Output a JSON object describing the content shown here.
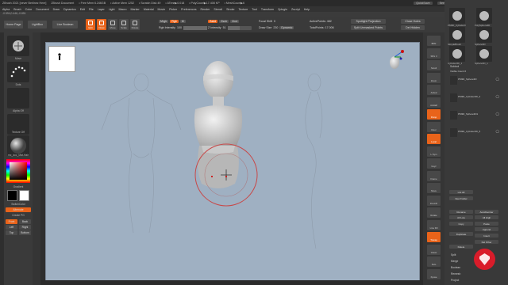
{
  "titlebar": {
    "app_title": "ZBrush 2021 [never Berlinez Here]",
    "document": "ZBrush Document",
    "free_mem": "• Free Mem 6.246GB",
    "active_mem": "• Active Mem 1252",
    "scratch": "• Scratch Disk 49",
    "atime": "• ATime▶0.018",
    "polycount": "• PolyCount▶17.408 KP",
    "meshcount": "• MeshCount▶6",
    "quicksave": "QuickSave",
    "see_through": "See-through  0",
    "menus": "Menus",
    "default_script": "DefaultZScript"
  },
  "menubar": [
    "Alpha",
    "Brush",
    "Color",
    "Document",
    "Draw",
    "Dynamics",
    "Edit",
    "File",
    "Layer",
    "Light",
    "Macro",
    "Marker",
    "Material",
    "Movie",
    "Picker",
    "Preferences",
    "Render",
    "Stencil",
    "Stroke",
    "Texture",
    "Tool",
    "Transform",
    "Zplugin",
    "Zscript",
    "Help"
  ],
  "coords": "-0.594,0.446,-0.851",
  "shelf": {
    "home_page": "Home Page",
    "lightbox": "LightBox",
    "live_boolean": "Live Boolean",
    "tools": [
      {
        "label": "Edit",
        "active": true
      },
      {
        "label": "Draw",
        "active": true
      },
      {
        "label": "Move",
        "active": false
      },
      {
        "label": "Scale",
        "active": false
      },
      {
        "label": "Rotate",
        "active": false
      }
    ],
    "mrgb": "Mrgb",
    "rgb": "Rgb",
    "m": "M",
    "rgb_intensity_label": "Rgb Intensity",
    "rgb_intensity_value": "100",
    "rgb_intensity": 1.0,
    "zadd": "Zadd",
    "zsub": "Zsub",
    "zcut": "Zcut",
    "z_intensity_label": "Z Intensity",
    "z_intensity_value": "51",
    "z_intensity": 0.51,
    "focal_shift_label": "Focal Shift",
    "focal_shift_value": "0",
    "draw_size_label": "Draw Size",
    "draw_size_value": "230",
    "dynamic": "Dynamic",
    "active_points": "ActivePoints: 482",
    "total_points": "TotalPoints: 17.006",
    "spotlight": "Spotlight Projection",
    "split_unmasked": "Split Unmasked Points",
    "close_holes": "Close Holes",
    "del_hidden": "Del Hidden"
  },
  "leftpanel": {
    "brush": "Move",
    "stroke": "Dots",
    "alpha": "Alpha Off",
    "texture": "Texture Off",
    "material": "mc_doc_Mat-Hair",
    "gradient": "Gradient",
    "switch_color": "SwitchColor",
    "alternate": "Alternate",
    "create_pc": "Create PG",
    "front": "Front",
    "back": "Back",
    "left": "Left",
    "right": "Right",
    "top": "Top",
    "bottom": "Bottom",
    "primary_color": "#000000",
    "secondary_color": "#ffffff"
  },
  "rtools": [
    {
      "label": "BPR",
      "active": false
    },
    {
      "label": "SPix 3",
      "active": false
    },
    {
      "label": "Scroll",
      "active": false
    },
    {
      "label": "Zoom",
      "active": false
    },
    {
      "label": "Actual",
      "active": false
    },
    {
      "label": "AAHalf",
      "active": false
    },
    {
      "label": "Persp",
      "active": true
    },
    {
      "label": "Floor",
      "active": false
    },
    {
      "label": "Local",
      "active": true
    },
    {
      "label": "L.Sym",
      "active": false
    },
    {
      "label": "Gxyz",
      "active": false
    },
    {
      "label": "Frame",
      "active": false
    },
    {
      "label": "Move",
      "active": false
    },
    {
      "label": "ZoomD",
      "active": false
    },
    {
      "label": "Rotate",
      "active": false
    },
    {
      "label": "Line Fill",
      "active": false
    },
    {
      "label": "Transp",
      "active": true
    },
    {
      "label": "Ghost",
      "active": false
    },
    {
      "label": "Solo",
      "active": false
    },
    {
      "label": "Xpose",
      "active": false
    }
  ],
  "subtool": {
    "thumbs": [
      {
        "label": "PM3D_Cylinder3"
      },
      {
        "label": "PolySphere3D"
      },
      {
        "label": "SimpleBrush"
      },
      {
        "label": "Sphere3D"
      },
      {
        "label": "Cylinder3D_1"
      },
      {
        "label": "Sphere3D_1"
      }
    ],
    "header": "Subtool",
    "visible_count": "Visible Count 6",
    "items": [
      {
        "name": "PM3D_Sphere3D"
      },
      {
        "name": "PM3D_Cylinder3D_2"
      },
      {
        "name": "PM3D_Sphere3D1"
      },
      {
        "name": "PM3D_Cylinder3D_5"
      }
    ],
    "list_all": "List All",
    "new_folder": "New Folder",
    "rename": "Rename",
    "auto_reorder": "AutoReorder",
    "all_low": "All Low",
    "all_high": "All High",
    "copy": "Copy",
    "paste": "Paste",
    "append": "Append",
    "duplicate": "Duplicate",
    "insert": "Insert",
    "del_other": "Del Other",
    "delete": "Delete",
    "split": "Split",
    "merge": "Merge",
    "boolean": "Boolean",
    "remesh": "Remesh",
    "project": "Project"
  }
}
